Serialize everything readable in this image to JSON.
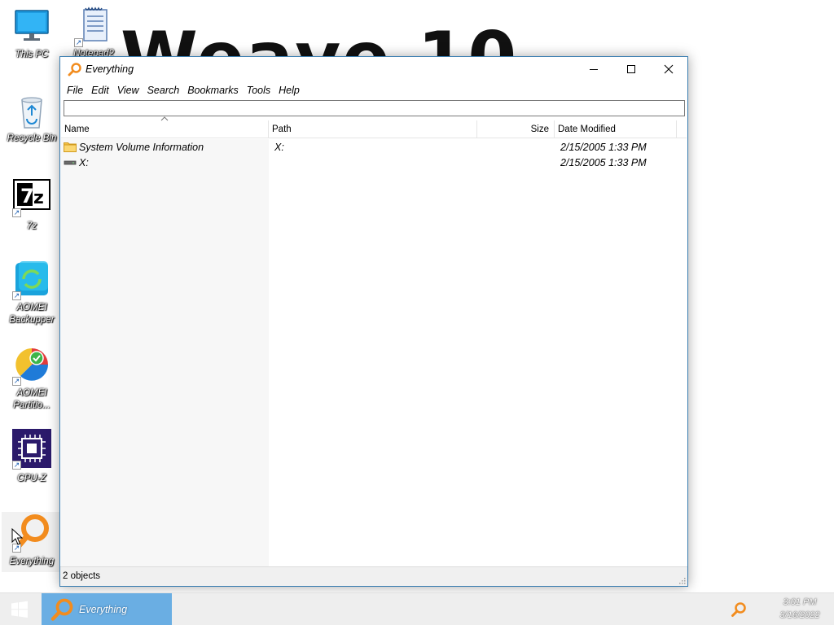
{
  "wallpaper": {
    "text": "Weave 10"
  },
  "desktop": {
    "icons": [
      {
        "label": "This PC",
        "icon": "monitor-icon",
        "shortcut": false
      },
      {
        "label": "Notepad2",
        "icon": "notepad-icon",
        "shortcut": true
      },
      {
        "label": "Recycle Bin",
        "icon": "recycle-bin-icon",
        "shortcut": false
      },
      {
        "label": "7z",
        "icon": "7zip-icon",
        "shortcut": true
      },
      {
        "label": "AOMEI Backupper",
        "icon": "aomei-backupper-icon",
        "shortcut": true
      },
      {
        "label": "AOMEI Partitio...",
        "icon": "aomei-partition-icon",
        "shortcut": true
      },
      {
        "label": "CPU-Z",
        "icon": "cpuz-icon",
        "shortcut": true
      },
      {
        "label": "Everything",
        "icon": "everything-icon",
        "shortcut": true
      }
    ]
  },
  "window": {
    "title": "Everything",
    "controls": [
      "minimize",
      "maximize",
      "close"
    ],
    "menu": [
      "File",
      "Edit",
      "View",
      "Search",
      "Bookmarks",
      "Tools",
      "Help"
    ],
    "search": {
      "value": "",
      "placeholder": ""
    },
    "columns": {
      "name": "Name",
      "path": "Path",
      "size": "Size",
      "date": "Date Modified"
    },
    "sort": {
      "column": "Name",
      "direction": "ascending"
    },
    "rows": [
      {
        "name": "System Volume Information",
        "icon": "folder-icon",
        "path": "X:",
        "size": "",
        "date": "2/15/2005 1:33 PM"
      },
      {
        "name": "X:",
        "icon": "drive-icon",
        "path": "",
        "size": "",
        "date": "2/15/2005 1:33 PM"
      }
    ],
    "status": "2 objects"
  },
  "taskbar": {
    "start_icon": "windows-logo-icon",
    "active_app": "Everything",
    "tray_icon": "everything-tray-icon",
    "clock": {
      "time": "3:01 PM",
      "date": "3/16/2022"
    }
  },
  "colors": {
    "taskbar_active": "#6aaee3",
    "window_border": "#3c7fb1",
    "everything_orange": "#f28c1e"
  }
}
